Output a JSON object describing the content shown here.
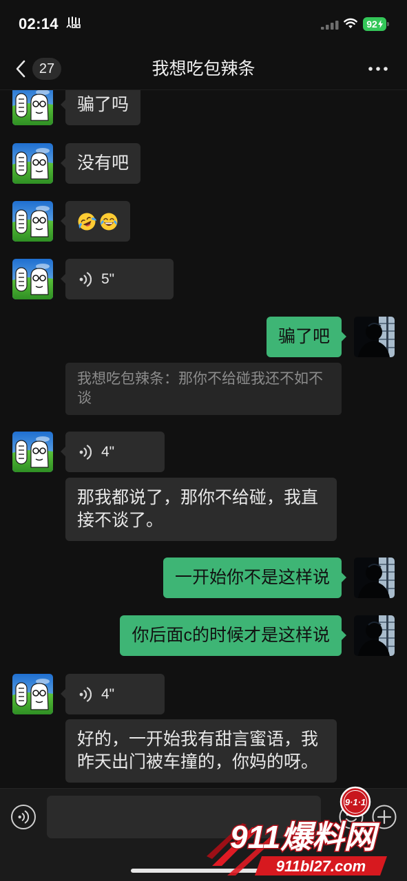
{
  "status_bar": {
    "time": "02:14",
    "battery_level": "92",
    "icons": [
      "status-indicator-icon",
      "signal-icon",
      "wifi-icon",
      "battery-charging-icon"
    ]
  },
  "header": {
    "back_icon": "chevron-left-icon",
    "unread_count": "27",
    "title": "我想吃包辣条",
    "more_icon": "more-dots-icon"
  },
  "messages": [
    {
      "sender": "friend",
      "type": "text",
      "text": "骗了吗"
    },
    {
      "sender": "friend",
      "type": "text",
      "text": "没有吧"
    },
    {
      "sender": "friend",
      "type": "emoji",
      "emojis": [
        "rolling-on-the-floor-laughing-emoji",
        "face-with-tears-of-joy-emoji"
      ]
    },
    {
      "sender": "friend",
      "type": "voice",
      "duration": "5\""
    },
    {
      "sender": "me",
      "type": "text",
      "text": "骗了吧",
      "quote": "我想吃包辣条：那你不给碰我还不如不谈"
    },
    {
      "sender": "friend",
      "type": "voice",
      "duration": "4\""
    },
    {
      "sender": "friend",
      "type": "text",
      "text": "那我都说了，那你不给碰，我直接不谈了。"
    },
    {
      "sender": "me",
      "type": "text",
      "text": "一开始你不是这样说"
    },
    {
      "sender": "me",
      "type": "text",
      "text": "你后面c的时候才是这样说"
    },
    {
      "sender": "friend",
      "type": "voice",
      "duration": "4\""
    },
    {
      "sender": "friend",
      "type": "text",
      "text": "好的，一开始我有甜言蜜语，我昨天出门被车撞的，你妈的呀。"
    }
  ],
  "input_bar": {
    "value": "",
    "voice_icon": "voice-input-icon",
    "emoji_icon": "emoji-icon",
    "plus_icon": "plus-icon"
  },
  "watermark": {
    "badge": "9·1·1",
    "brand": "911爆料网",
    "url": "911bl27.com"
  },
  "colors": {
    "background": "#111111",
    "bubble_friend": "#2c2c2c",
    "bubble_me": "#3eb575",
    "quote_bubble": "#262626",
    "battery": "#34c759",
    "brand_red": "#d7191f"
  }
}
